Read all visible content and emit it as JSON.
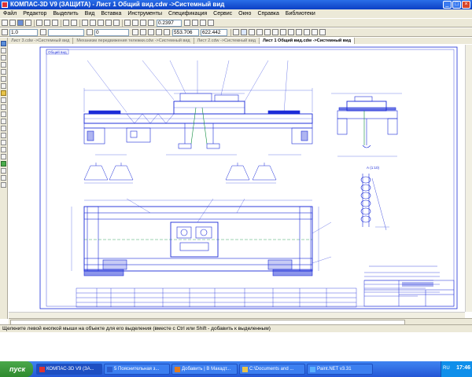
{
  "window": {
    "title": "КОМПАС-3D V9 (ЗАЩИТА) - Лист 1 Общий вид.cdw ->Системный вид"
  },
  "menu": [
    "Файл",
    "Редактор",
    "Выделить",
    "Вид",
    "Вставка",
    "Инструменты",
    "Спецификация",
    "Сервис",
    "Окно",
    "Справка",
    "Библиотеки"
  ],
  "toolbar": {
    "style_value": "1.0",
    "layer_value": "0",
    "zoom_value": "0.2397",
    "coord_x": "553.706",
    "coord_y": "622.442"
  },
  "tabs": [
    "Лист 3.cdw ->Системный вид",
    "Механизм передвижения тележки.cdw ->Системный вид",
    "Лист 2.cdw ->Системный вид",
    "Лист 1 Общий вид.cdw ->Системный вид"
  ],
  "drawing": {
    "stamp": "Общий вид",
    "view_label": "А (1:10)"
  },
  "status": "Щелкните левой кнопкой мыши на объекте для его выделения (вместе с Ctrl или Shift - добавить к выделенным)",
  "taskbar": {
    "start": "пуск",
    "tasks": [
      "КОМПАС-3D V9 (ЗА...",
      "5 Пояснительная з...",
      "Добавить | В Макадт...",
      "C:\\Documents and ...",
      "Paint.NET v3.31"
    ],
    "lang": "RU",
    "clock": "17:46"
  },
  "colors": {
    "drawing_blue": "#1a2bd8",
    "drawing_green": "#0a8a3a",
    "titlebar": "#0b3fc4"
  }
}
